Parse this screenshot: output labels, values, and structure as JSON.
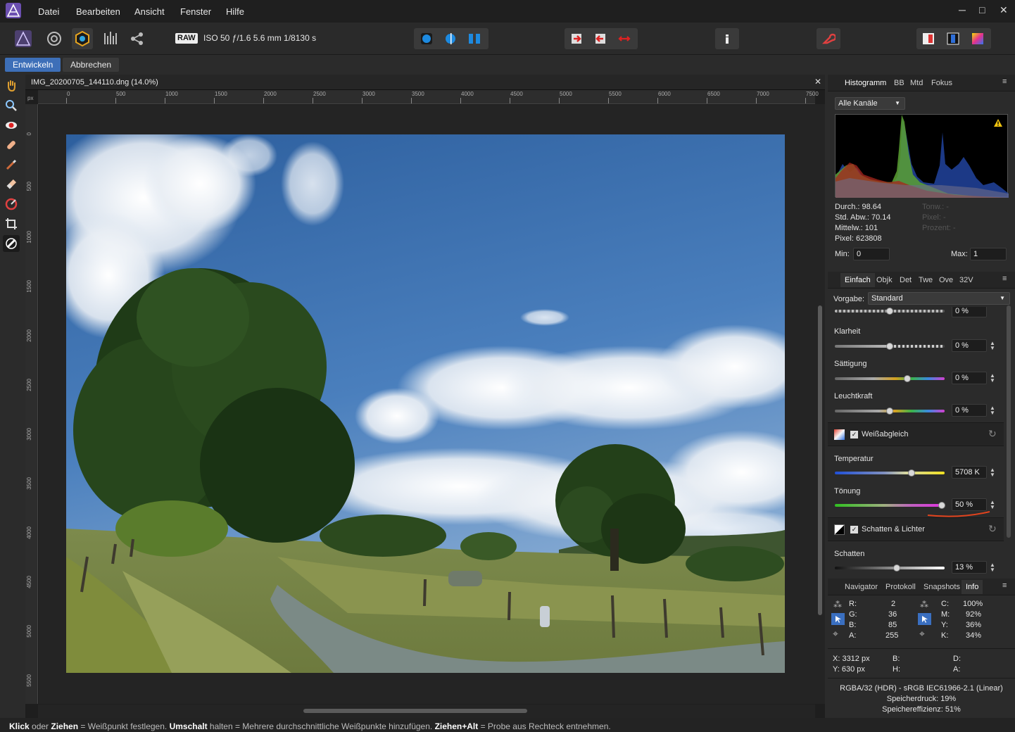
{
  "menubar": {
    "items": [
      "Datei",
      "Bearbeiten",
      "Ansicht",
      "Fenster",
      "Hilfe"
    ],
    "window_controls": {
      "minimize": "─",
      "maximize": "□",
      "close": "✕"
    }
  },
  "toolbar": {
    "raw_badge": "RAW",
    "exif": "ISO 50 ƒ/1.6 5.6 mm 1/8130 s"
  },
  "context": {
    "develop_label": "Entwickeln",
    "cancel_label": "Abbrechen"
  },
  "document": {
    "title": "IMG_20200705_144110.dng (14.0%)",
    "close": "✕",
    "ruler_unit": "px",
    "ruler_h": [
      "0",
      "500",
      "1000",
      "1500",
      "2000",
      "2500",
      "3000",
      "3500",
      "4000",
      "4500",
      "5000",
      "5500",
      "6000",
      "6500",
      "7000",
      "7500"
    ],
    "ruler_v": [
      "0",
      "500",
      "1000",
      "1500",
      "2000",
      "2500",
      "3000",
      "3500",
      "4000",
      "4500",
      "5000",
      "5500"
    ]
  },
  "histogram_panel": {
    "tabs": [
      "Histogramm",
      "BB",
      "Mtd",
      "Fokus"
    ],
    "channel": "Alle Kanäle",
    "stats_left": [
      "Durch.: 98.64",
      "Std. Abw.: 70.14",
      "Mittelw.: 101",
      "Pixel: 623808"
    ],
    "stats_right": [
      "Tonw.: -",
      "Pixel: -",
      "Prozent: -"
    ],
    "min_label": "Min:",
    "min_value": "0",
    "max_label": "Max:",
    "max_value": "1"
  },
  "develop_panel": {
    "tabs": [
      "Einfach",
      "Objk",
      "Det",
      "Twe",
      "Ove",
      "32V"
    ],
    "preset_label": "Vorgabe:",
    "preset_value": "Standard",
    "partial_value": "0 %",
    "sliders": [
      {
        "label": "Klarheit",
        "value": "0 %"
      },
      {
        "label": "Sättigung",
        "value": "0 %"
      },
      {
        "label": "Leuchtkraft",
        "value": "0 %"
      }
    ],
    "wb_section": "Weißabgleich",
    "temperature": {
      "label": "Temperatur",
      "value": "5708 K"
    },
    "tint": {
      "label": "Tönung",
      "value": "50 %"
    },
    "sl_section": "Schatten & Lichter",
    "shadows": {
      "label": "Schatten",
      "value": "13 %"
    }
  },
  "info_panel": {
    "tabs": [
      "Navigator",
      "Protokoll",
      "Snapshots",
      "Info"
    ],
    "rgba": [
      [
        "R:",
        "2"
      ],
      [
        "G:",
        "36"
      ],
      [
        "B:",
        "85"
      ],
      [
        "A:",
        "255"
      ]
    ],
    "cmyk": [
      [
        "C:",
        "100%"
      ],
      [
        "M:",
        "92%"
      ],
      [
        "Y:",
        "36%"
      ],
      [
        "K:",
        "34%"
      ]
    ],
    "pos_x": "X: 3312 px",
    "pos_y": "Y: 630 px",
    "b_label": "B:",
    "h_label": "H:",
    "d_label": "D:",
    "a_label": "A:",
    "format": "RGBA/32 (HDR) - sRGB IEC61966-2.1 (Linear)",
    "memory_pressure": "Speicherdruck: 19%",
    "memory_efficiency": "Speichereffizienz: 51%"
  },
  "status": {
    "k1": "Klick",
    "t1": " oder ",
    "k2": "Ziehen",
    "t2": " = Weißpunkt festlegen. ",
    "k3": "Umschalt",
    "t3": " halten = Mehrere durchschnittliche Weißpunkte hinzufügen. ",
    "k4": "Ziehen+Alt",
    "t4": " = Probe aus Rechteck entnehmen."
  },
  "colors": {
    "accent": "#3d6fb8",
    "annotation": "#e2431d",
    "warning": "#f1c40f"
  }
}
